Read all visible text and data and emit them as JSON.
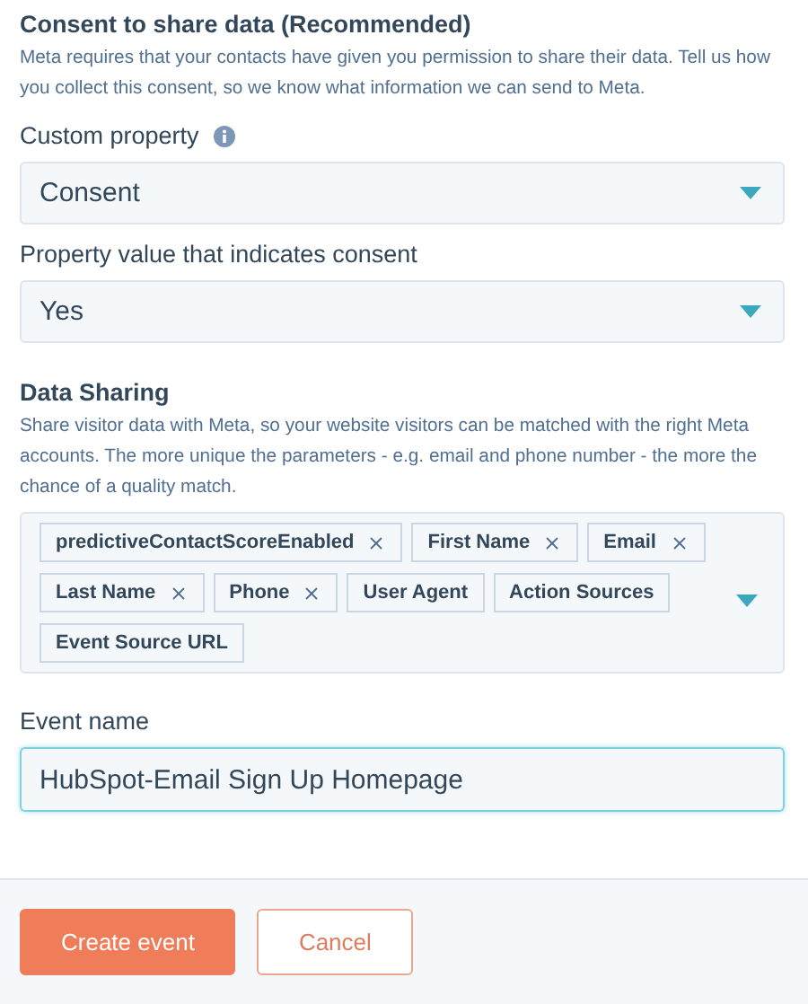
{
  "consent": {
    "title": "Consent to share data (Recommended)",
    "description": "Meta requires that your contacts have given you permission to share their data. Tell us how you collect this consent, so we know what information we can send to Meta."
  },
  "custom_property": {
    "label": "Custom property",
    "value": "Consent"
  },
  "property_value": {
    "label": "Property value that indicates consent",
    "value": "Yes"
  },
  "data_sharing": {
    "title": "Data Sharing",
    "description": "Share visitor data with Meta, so your website visitors can be matched with the right Meta accounts. The more unique the parameters - e.g. email and phone number - the more the chance of a quality match.",
    "tags": [
      {
        "label": "predictiveContactScoreEnabled",
        "removable": true
      },
      {
        "label": "First Name",
        "removable": true
      },
      {
        "label": "Email",
        "removable": true
      },
      {
        "label": "Last Name",
        "removable": true
      },
      {
        "label": "Phone",
        "removable": true
      },
      {
        "label": "User Agent",
        "removable": false
      },
      {
        "label": "Action Sources",
        "removable": false
      },
      {
        "label": "Event Source URL",
        "removable": false
      }
    ]
  },
  "event_name": {
    "label": "Event name",
    "value": "HubSpot-Email Sign Up Homepage"
  },
  "buttons": [
    {
      "label": "Create event",
      "kind": "primary"
    },
    {
      "label": "Cancel",
      "kind": "secondary"
    }
  ]
}
